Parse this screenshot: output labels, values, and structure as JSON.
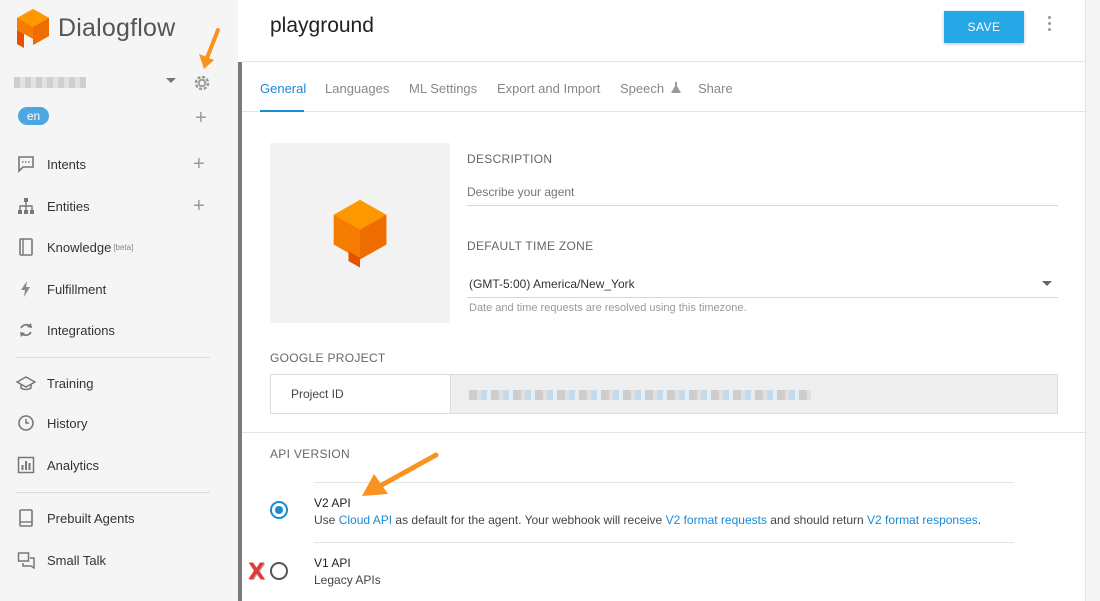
{
  "app": {
    "name": "Dialogflow"
  },
  "sidebar": {
    "language_chip": "en",
    "items": [
      {
        "label": "Intents",
        "icon": "chat-bubble-icon"
      },
      {
        "label": "Entities",
        "icon": "hierarchy-icon"
      },
      {
        "label": "Knowledge",
        "badge": "[beta]",
        "icon": "book-icon"
      },
      {
        "label": "Fulfillment",
        "icon": "lightning-icon"
      },
      {
        "label": "Integrations",
        "icon": "refresh-icon"
      },
      {
        "label": "Training",
        "icon": "graduation-cap-icon"
      },
      {
        "label": "History",
        "icon": "clock-icon"
      },
      {
        "label": "Analytics",
        "icon": "bar-chart-icon"
      },
      {
        "label": "Prebuilt Agents",
        "icon": "book-icon"
      },
      {
        "label": "Small Talk",
        "icon": "chat-icon"
      }
    ]
  },
  "header": {
    "title": "playground",
    "save_label": "SAVE"
  },
  "tabs": [
    {
      "label": "General",
      "active": true
    },
    {
      "label": "Languages"
    },
    {
      "label": "ML Settings"
    },
    {
      "label": "Export and Import"
    },
    {
      "label": "Speech"
    },
    {
      "label": "Share"
    }
  ],
  "general": {
    "description_label": "DESCRIPTION",
    "description_placeholder": "Describe your agent",
    "timezone_label": "DEFAULT TIME ZONE",
    "timezone_value": "(GMT-5:00) America/New_York",
    "timezone_hint": "Date and time requests are resolved using this timezone.",
    "google_project_label": "GOOGLE PROJECT",
    "project_id_label": "Project ID",
    "api_version_label": "API VERSION",
    "api_options": [
      {
        "title": "V2 API",
        "selected": true,
        "desc_parts": [
          "Use ",
          "Cloud API",
          " as default for the agent. Your webhook will receive ",
          "V2 format requests",
          " and should return ",
          "V2 format responses",
          "."
        ]
      },
      {
        "title": "V1 API",
        "selected": false,
        "desc": "Legacy APIs"
      }
    ],
    "rejected_mark": "X"
  },
  "colors": {
    "accent": "#1a8ad6",
    "save_button": "#27a8e6",
    "logo_orange": "#f57c00",
    "annotation_arrow": "#f7931e"
  }
}
